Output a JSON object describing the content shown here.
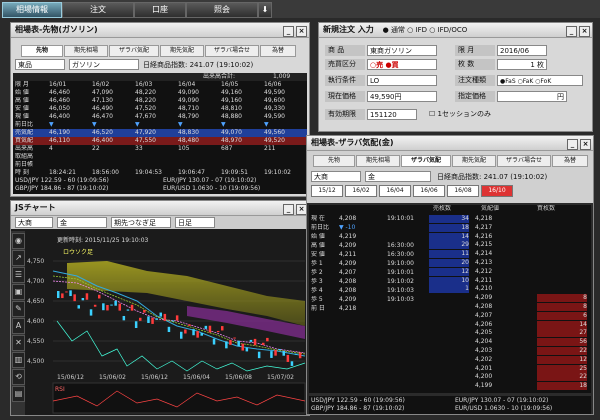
{
  "topnav": {
    "tabs": [
      "相場情報",
      "注文",
      "口座",
      "照会"
    ],
    "arrow": "⬇"
  },
  "quote_panel": {
    "title": "相場表-先物(ガソリン)",
    "tabs": [
      "先物",
      "期先相場",
      "ザラバ気配",
      "期先気配",
      "ザラバ場合せ",
      "為替"
    ],
    "market": "東品",
    "product": "ガソリン",
    "date_label": "日経商品指数:",
    "date_value": "241.07 (19:10:02)",
    "sub_header": "出来高合計:",
    "sub_value": "1,009",
    "col_months": [
      "16/01",
      "16/02",
      "16/03",
      "16/04",
      "16/05",
      "16/06"
    ],
    "rows": [
      {
        "label": "限 月",
        "values": [
          "16/01",
          "16/02",
          "16/03",
          "16/04",
          "16/05",
          "16/06"
        ]
      },
      {
        "label": "始 値",
        "values": [
          "46,460",
          "47,090",
          "48,220",
          "49,090",
          "49,160",
          "49,590"
        ]
      },
      {
        "label": "高 値",
        "values": [
          "46,460",
          "47,130",
          "48,220",
          "49,090",
          "49,160",
          "49,600"
        ]
      },
      {
        "label": "安 値",
        "values": [
          "46,050",
          "46,490",
          "47,520",
          "48,710",
          "48,810",
          "49,330"
        ]
      },
      {
        "label": "現 値",
        "values": [
          "46,400",
          "46,470",
          "47,670",
          "48,790",
          "48,880",
          "49,590"
        ]
      },
      {
        "label": "前日比",
        "values": [
          "▼",
          "▼",
          "▼",
          "▼",
          "▼",
          "▼"
        ]
      },
      {
        "label": "売気配",
        "values": [
          "46,190",
          "46,520",
          "47,920",
          "48,830",
          "49,070",
          "49,560"
        ]
      },
      {
        "label": "買気配",
        "values": [
          "46,110",
          "46,400",
          "47,550",
          "48,480",
          "48,970",
          "49,520"
        ]
      },
      {
        "label": "出来高",
        "values": [
          "4",
          "22",
          "33",
          "105",
          "687",
          "211"
        ]
      },
      {
        "label": "取組高",
        "values": [
          "",
          "",
          "",
          "",
          "",
          ""
        ]
      },
      {
        "label": "前日帳",
        "values": [
          "",
          "",
          "",
          "",
          "",
          ""
        ]
      },
      {
        "label": "時 刻",
        "values": [
          "18:24:21",
          "18:56:00",
          "19:04:53",
          "19:06:47",
          "19:09:51",
          "19:10:02"
        ]
      }
    ],
    "fx": [
      "USD/JPY 122.59 - 60 (19:09:56)",
      "EUR/JPY 130.07 - 07 (19:10:02)",
      "GBP/JPY 184.86 - 87 (19:10:02)",
      "EUR/USD 1.0630 - 10 (19:09:56)"
    ]
  },
  "order_panel": {
    "title": "新規注文 入力",
    "modes": [
      "通常",
      "IFD",
      "IFD/OCO"
    ],
    "fields": [
      {
        "label": "商 品",
        "value": "東商ガソリン"
      },
      {
        "label": "売買区分",
        "value": "○売 ●買"
      },
      {
        "label": "執行条件",
        "value": "LO"
      },
      {
        "label": "現在価格",
        "value": "49,590円"
      },
      {
        "label": "有効期限",
        "value": "151120"
      }
    ],
    "right_fields": [
      {
        "label": "限 月",
        "value": "2016/06"
      },
      {
        "label": "枚 数",
        "value": "1 枚"
      },
      {
        "label": "注文種類",
        "value": "●FaS ○FaK ○FoK"
      },
      {
        "label": "指定価格",
        "value": "円"
      }
    ],
    "session_label": "1セッションのみ"
  },
  "chart_panel": {
    "title": "JSチャート",
    "market": "大商",
    "product": "金",
    "period": "期先つなぎ足",
    "interval": "日足",
    "updated": "更新時刻: 2015/11/25 19:10:03",
    "legend": "ロウソク足",
    "y_ticks": [
      "4,750",
      "4,700",
      "4,650",
      "4,600",
      "4,550",
      "4,500"
    ],
    "x_ticks": [
      "15/06/12",
      "15/06/02",
      "15/06/12",
      "15/06/04",
      "15/06/08",
      "15/07/02"
    ],
    "rsi_label": "RSI",
    "left_tools": [
      "◉",
      "↗",
      "☰",
      "▣",
      "✎",
      "A",
      "✕",
      "▥",
      "⟲",
      "▤"
    ]
  },
  "zaraba_panel": {
    "title": "相場表-ザラバ気配(金)",
    "tabs": [
      "先物",
      "期先相場",
      "ザラバ気配",
      "期先気配",
      "ザラバ場合せ",
      "為替"
    ],
    "market": "大商",
    "product": "金",
    "date_label": "日経商品指数:",
    "date_value": "241.07 (19:10:02)",
    "months": [
      "15/12",
      "16/02",
      "16/04",
      "16/06",
      "16/08",
      "16/10"
    ],
    "col_headers": [
      "",
      "売枚数",
      "気配値",
      "買枚数"
    ],
    "info_rows": [
      {
        "label": "現 在",
        "value": "4,208",
        "time": "19:10:01"
      },
      {
        "label": "前日比",
        "value": "▼ -10",
        "": ""
      },
      {
        "label": "始 値",
        "value": "4,219",
        "time": ""
      },
      {
        "label": "高 値",
        "value": "4,209",
        "time": "16:30:00"
      },
      {
        "label": "安 値",
        "value": "4,211",
        "time": "16:30:00"
      },
      {
        "label": "歩 1",
        "value": "4,209",
        "time": "19:10:00"
      },
      {
        "label": "歩 2",
        "value": "4,207",
        "time": "19:10:01"
      },
      {
        "label": "歩 3",
        "value": "4,208",
        "time": "19:10:02"
      },
      {
        "label": "歩 4",
        "value": "4,208",
        "time": "19:10:03"
      },
      {
        "label": "歩 5",
        "value": "4,209",
        "time": "19:10:03"
      },
      {
        "label": "前 日",
        "value": "4,218",
        "time": ""
      }
    ],
    "ask_sizes": [
      "34",
      "18",
      "14",
      "29",
      "11",
      "20",
      "12",
      "10",
      "1"
    ],
    "prices": [
      "4,218",
      "4,217",
      "4,216",
      "4,215",
      "4,214",
      "4,213",
      "4,212",
      "4,211",
      "4,210",
      "4,209",
      "4,208",
      "4,207",
      "4,206",
      "4,205",
      "4,204",
      "4,203",
      "4,202",
      "4,201",
      "4,200",
      "4,199"
    ],
    "bid_sizes": [
      "8",
      "8",
      "6",
      "14",
      "27",
      "56",
      "22",
      "12",
      "25",
      "22",
      "18"
    ],
    "fx": [
      "USD/JPY 122.59 - 60 (19:09:56)",
      "EUR/JPY 130.07 - 07 (19:10:02)",
      "GBP/JPY 184.86 - 87 (19:10:02)",
      "EUR/USD 1.0630 - 10 (19:09:56)"
    ]
  }
}
